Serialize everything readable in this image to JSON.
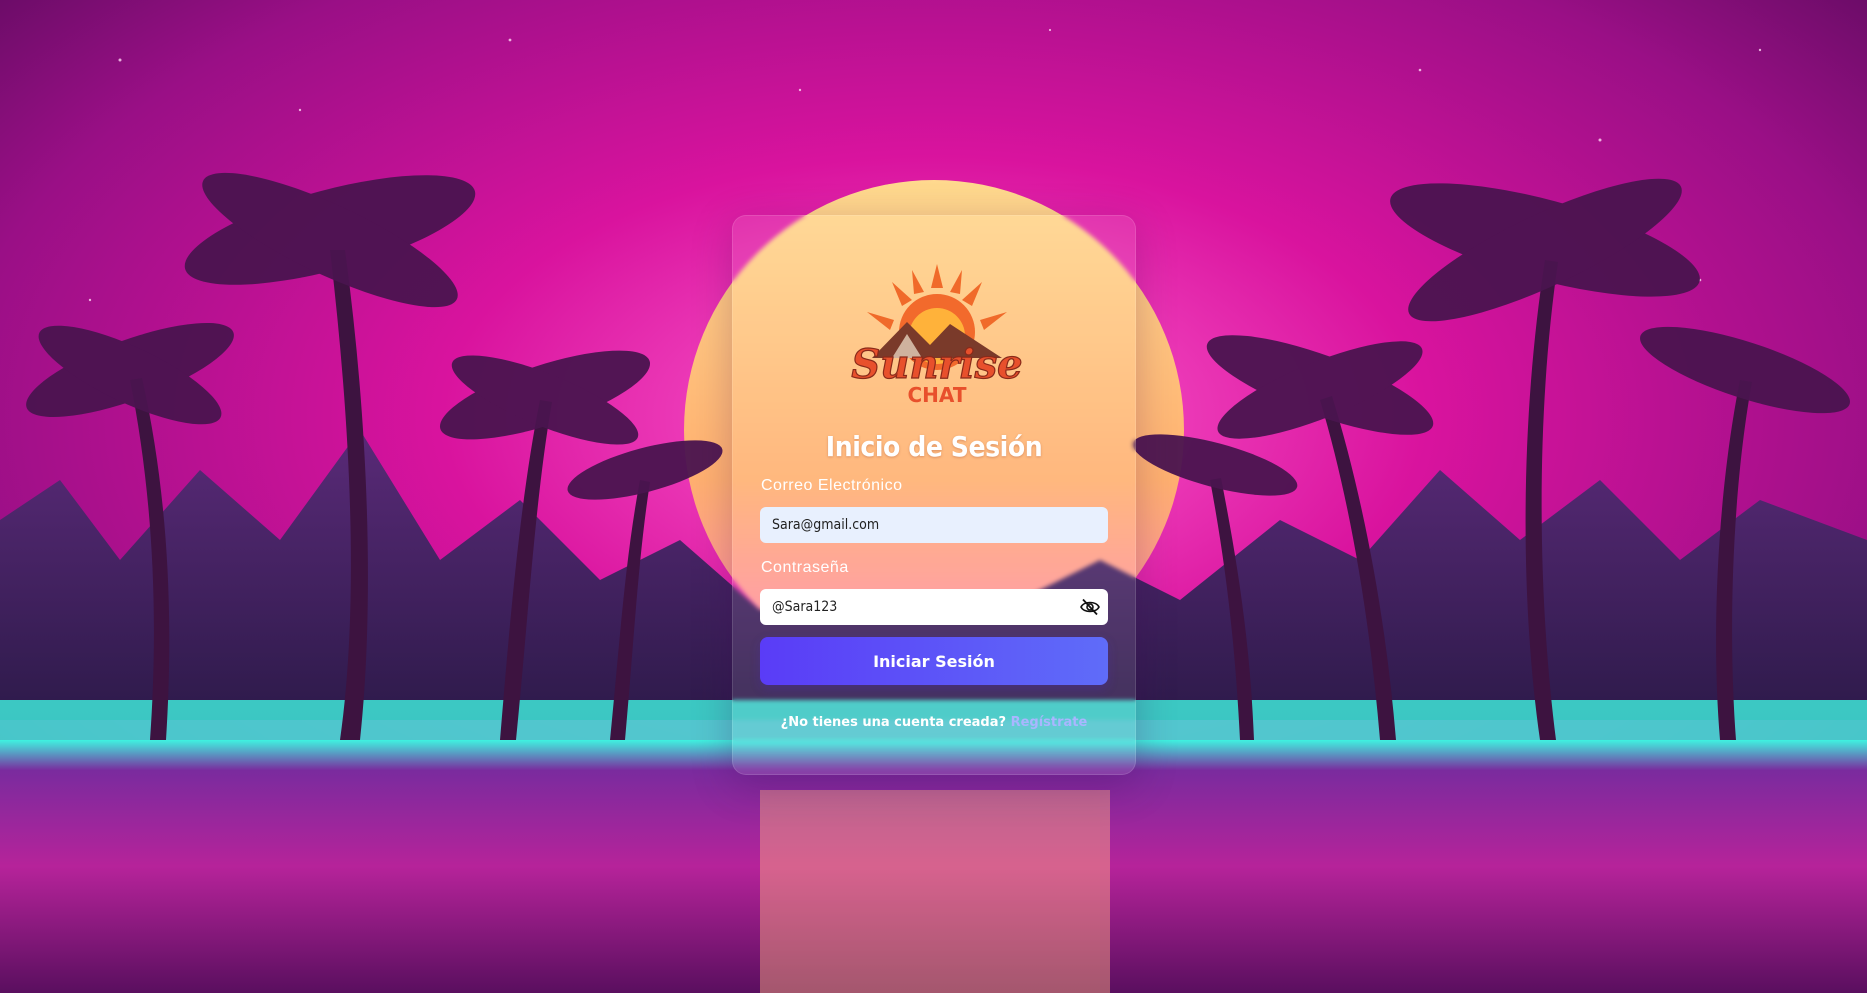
{
  "brand": {
    "logo_line1": "Sunrise",
    "logo_line2": "CHAT"
  },
  "login": {
    "title": "Inicio de Sesión",
    "email_label": "Correo Electrónico",
    "email_value": "Sara@gmail.com",
    "password_label": "Contraseña",
    "password_value": "@Sara123",
    "submit_label": "Iniciar Sesión",
    "signup_prompt": "¿No tienes una cuenta creada?",
    "signup_link": "Regístrate"
  },
  "icons": {
    "password_toggle": "eye-slash-icon"
  },
  "colors": {
    "button": "#5a3cf7",
    "link": "#a9b6ff",
    "sky": "#c2148f",
    "sun": "#ffb86a",
    "glow": "#3ee6d8"
  }
}
